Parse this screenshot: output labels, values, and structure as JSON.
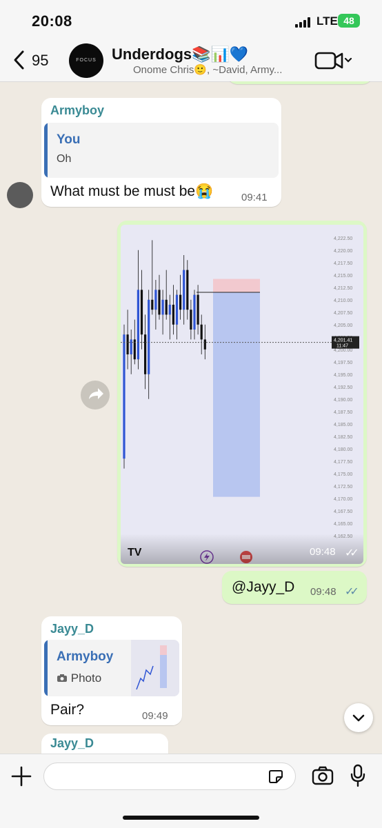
{
  "status_bar": {
    "time": "20:08",
    "network": "LTE",
    "battery": "48"
  },
  "header": {
    "back_count": "95",
    "avatar_text": "FOCUS",
    "group_name": "Underdogs📚📊💙",
    "members": "Onome Chris🙂, ~David, Army..."
  },
  "messages": {
    "m1": {
      "sender": "Armyboy",
      "quote_name": "You",
      "quote_text": "Oh",
      "text": "What must be must be😭",
      "time": "09:41"
    },
    "m2": {
      "time": "09:48",
      "chart_price_label": "4,201.41",
      "chart_time_label": "11:47",
      "logo": "TV"
    },
    "m3": {
      "text": "@Jayy_D",
      "time": "09:48"
    },
    "m4": {
      "sender": "Jayy_D",
      "quote_name": "Armyboy",
      "quote_text": "Photo",
      "text": "Pair?",
      "time": "09:49"
    },
    "m5": {
      "sender": "Jayy_D"
    }
  },
  "chart_data": {
    "type": "candlestick",
    "y_ticks": [
      "4,222.50",
      "4,220.00",
      "4,217.50",
      "4,215.00",
      "4,212.50",
      "4,210.00",
      "4,207.50",
      "4,205.00",
      "4,202.50",
      "4,200.00",
      "4,197.50",
      "4,195.00",
      "4,192.50",
      "4,190.00",
      "4,187.50",
      "4,185.00",
      "4,182.50",
      "4,180.00",
      "4,177.50",
      "4,175.00",
      "4,172.50",
      "4,170.00",
      "4,167.50",
      "4,165.00",
      "4,162.50"
    ],
    "ylim": [
      4161.5,
      4224
    ],
    "current_price": 4201.41,
    "candles": [
      {
        "o": 4178,
        "h": 4205,
        "l": 4176,
        "c": 4203
      },
      {
        "o": 4203,
        "h": 4208,
        "l": 4196,
        "c": 4199
      },
      {
        "o": 4199,
        "h": 4204,
        "l": 4195,
        "c": 4202
      },
      {
        "o": 4202,
        "h": 4206,
        "l": 4197,
        "c": 4198
      },
      {
        "o": 4198,
        "h": 4220,
        "l": 4196,
        "c": 4212
      },
      {
        "o": 4212,
        "h": 4216,
        "l": 4200,
        "c": 4203
      },
      {
        "o": 4203,
        "h": 4207,
        "l": 4192,
        "c": 4195
      },
      {
        "o": 4195,
        "h": 4212,
        "l": 4190,
        "c": 4210
      },
      {
        "o": 4210,
        "h": 4222,
        "l": 4207,
        "c": 4208
      },
      {
        "o": 4208,
        "h": 4214,
        "l": 4204,
        "c": 4212
      },
      {
        "o": 4212,
        "h": 4215,
        "l": 4206,
        "c": 4207
      },
      {
        "o": 4207,
        "h": 4212,
        "l": 4203,
        "c": 4210
      },
      {
        "o": 4210,
        "h": 4216,
        "l": 4206,
        "c": 4207
      },
      {
        "o": 4207,
        "h": 4211,
        "l": 4202,
        "c": 4209
      },
      {
        "o": 4209,
        "h": 4213,
        "l": 4203,
        "c": 4205
      },
      {
        "o": 4205,
        "h": 4212,
        "l": 4202,
        "c": 4211
      },
      {
        "o": 4211,
        "h": 4215,
        "l": 4206,
        "c": 4208
      },
      {
        "o": 4208,
        "h": 4219,
        "l": 4205,
        "c": 4216
      },
      {
        "o": 4216,
        "h": 4218,
        "l": 4206,
        "c": 4208
      },
      {
        "o": 4208,
        "h": 4210,
        "l": 4202,
        "c": 4204
      },
      {
        "o": 4204,
        "h": 4212,
        "l": 4202,
        "c": 4211
      },
      {
        "o": 4211,
        "h": 4213,
        "l": 4203,
        "c": 4205
      },
      {
        "o": 4205,
        "h": 4207,
        "l": 4199,
        "c": 4202
      },
      {
        "o": 4202,
        "h": 4205,
        "l": 4198,
        "c": 4200
      }
    ],
    "short_position": {
      "entry": 4211.5,
      "stop": 4214.2,
      "target": 4170.3
    },
    "colors": {
      "up": "#2f55d4",
      "down": "#111111",
      "stop_zone": "#f2c9cf",
      "target_zone": "#b8c6f0"
    }
  }
}
